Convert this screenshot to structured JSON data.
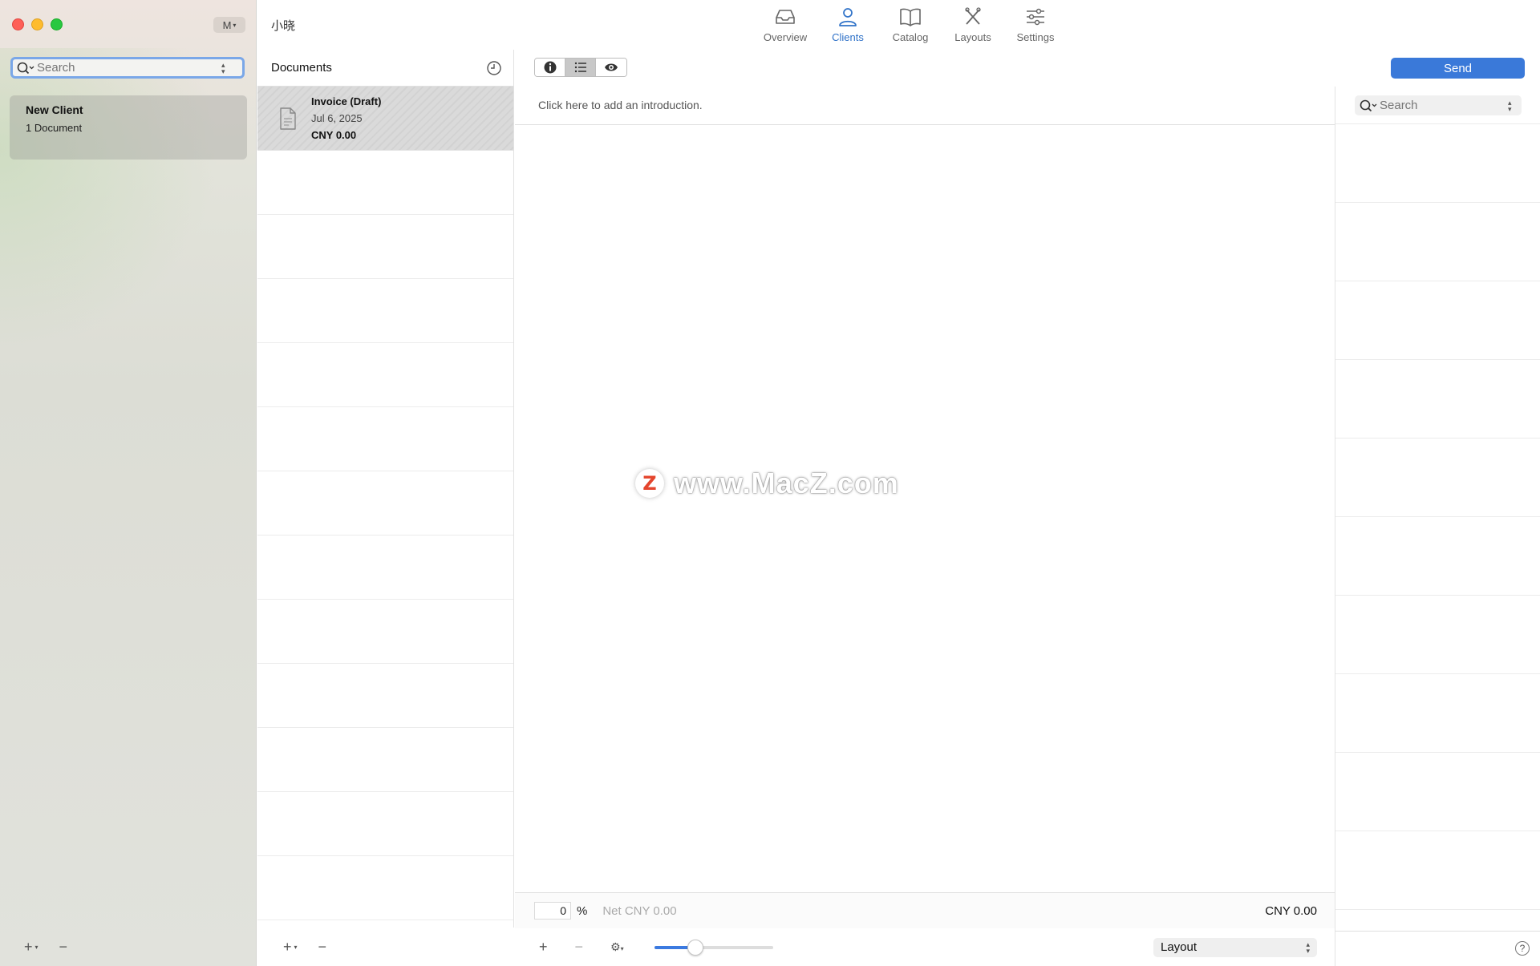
{
  "window": {
    "title": "小晓",
    "account_button": "M"
  },
  "toolbar": {
    "items": [
      {
        "label": "Overview",
        "icon": "tray-icon"
      },
      {
        "label": "Clients",
        "icon": "person-icon"
      },
      {
        "label": "Catalog",
        "icon": "book-icon"
      },
      {
        "label": "Layouts",
        "icon": "scissors-ruler-icon"
      },
      {
        "label": "Settings",
        "icon": "sliders-icon"
      }
    ],
    "active": "Clients",
    "accent_color": "#2f72c8"
  },
  "sidebar": {
    "search_placeholder": "Search",
    "clients": [
      {
        "name": "New Client",
        "documents": "1 Document"
      }
    ]
  },
  "documents": {
    "header": "Documents",
    "items": [
      {
        "title": "Invoice (Draft)",
        "date": "Jul 6, 2025",
        "amount": "CNY 0.00"
      }
    ]
  },
  "editor": {
    "intro_placeholder": "Click here to add an introduction.",
    "discount_value": "0",
    "percent_sign": "%",
    "net_label": "Net CNY 0.00",
    "total": "CNY 0.00",
    "zoom_fraction": 0.35,
    "layout_select": "Layout"
  },
  "catalog": {
    "send_label": "Send",
    "search_placeholder": "Search",
    "send_color": "#3a79d9"
  },
  "watermark": {
    "logo_letter": "Z",
    "text": "www.MacZ.com"
  }
}
